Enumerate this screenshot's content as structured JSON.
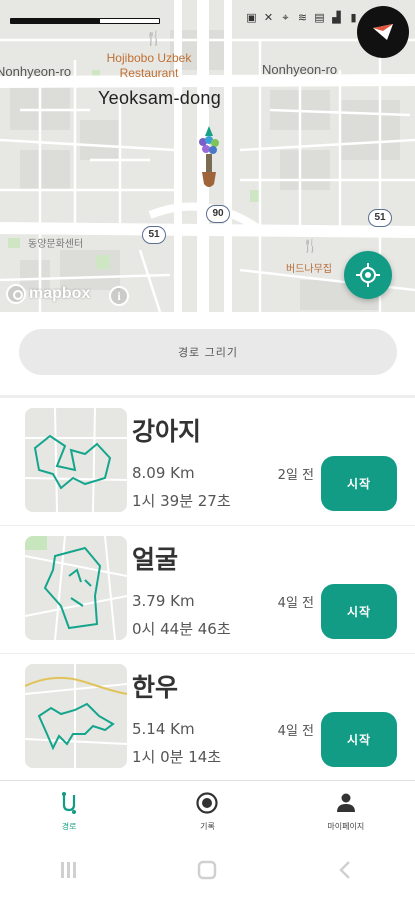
{
  "status_bar": {
    "progress": 0.6,
    "icons": [
      "image-icon",
      "network-icon",
      "location-icon",
      "wifi-icon",
      "hd-icon",
      "signal-icon",
      "battery-icon"
    ]
  },
  "map": {
    "restaurant_name": "Hojibobo Uzbek Restaurant",
    "road_left": "Nonhyeon-ro",
    "road_right": "Nonhyeon-ro",
    "district": "Yeoksam-dong",
    "poi_left": "동양문화센터",
    "poi_right": "버드나무집",
    "route_shields": [
      "90",
      "51",
      "51"
    ],
    "attribution": "mapbox",
    "colors": {
      "accent": "#129c86",
      "poi": "#c07034"
    }
  },
  "draw_route": {
    "label": "경로 그리기"
  },
  "routes": [
    {
      "name": "강아지",
      "distance": "8.09 Km",
      "duration": "1시 39분 27초",
      "ago": "2일 전",
      "start_label": "시작"
    },
    {
      "name": "얼굴",
      "distance": "3.79 Km",
      "duration": "0시 44분 46초",
      "ago": "4일 전",
      "start_label": "시작"
    },
    {
      "name": "한우",
      "distance": "5.14 Km",
      "duration": "1시 0분 14초",
      "ago": "4일 전",
      "start_label": "시작"
    }
  ],
  "bottom_nav": {
    "items": [
      {
        "label": "경로",
        "icon": "route-icon",
        "active": true
      },
      {
        "label": "기록",
        "icon": "record-icon",
        "active": false
      },
      {
        "label": "마이페이지",
        "icon": "person-icon",
        "active": false
      }
    ]
  }
}
